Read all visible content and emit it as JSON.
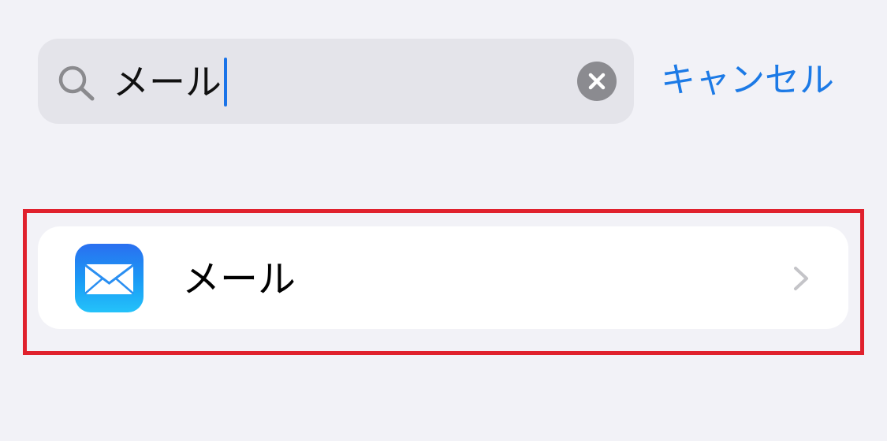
{
  "search": {
    "query": "メール",
    "search_icon": "magnifying-glass-icon",
    "clear_icon": "clear-x-circle-icon"
  },
  "header": {
    "cancel_label": "キャンセル"
  },
  "results": [
    {
      "label": "メール",
      "icon": "mail-envelope-icon",
      "accessory": "chevron-right-icon"
    }
  ],
  "colors": {
    "background": "#f2f2f7",
    "search_field": "#e4e4ea",
    "accent": "#1c7ae6",
    "caret": "#1a73e8",
    "highlight": "#e0212d",
    "row": "#ffffff",
    "chevron": "#c4c4c8"
  }
}
